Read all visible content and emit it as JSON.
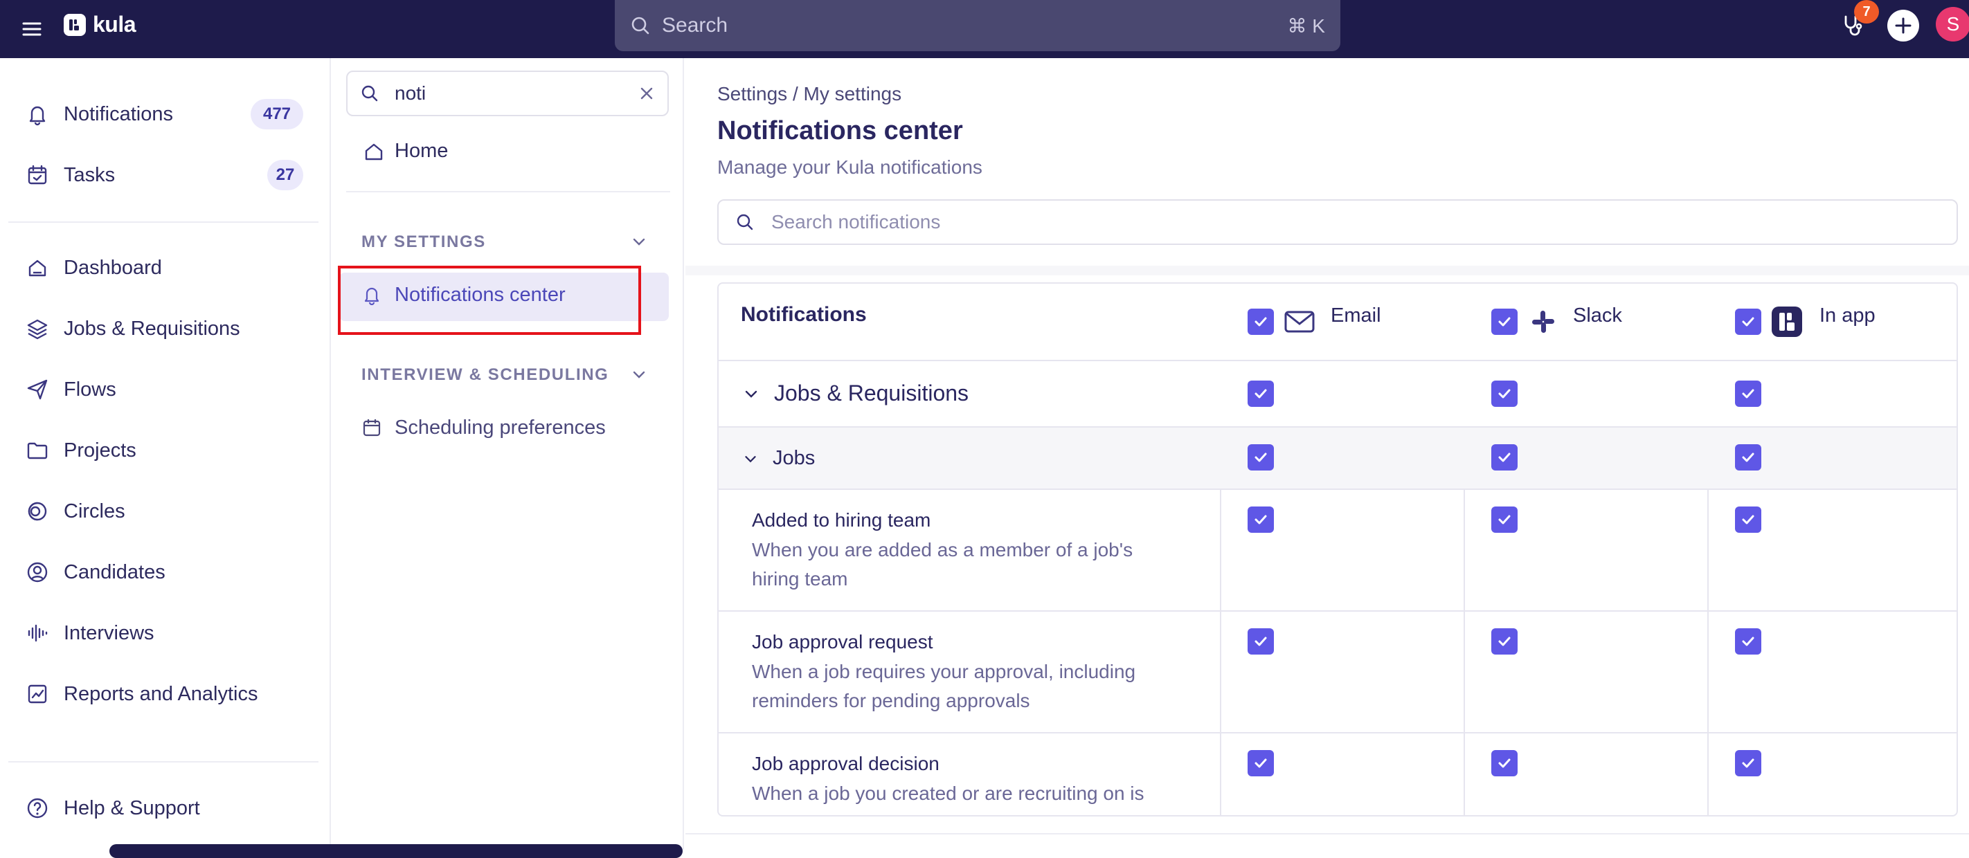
{
  "app": {
    "name": "kula"
  },
  "topbar": {
    "search_placeholder": "Search",
    "search_shortcut": "⌘ K",
    "notification_badge": "7",
    "avatar_initial": "S"
  },
  "sidebar": {
    "items": [
      {
        "label": "Notifications",
        "count": "477",
        "icon": "bell-icon"
      },
      {
        "label": "Tasks",
        "count": "27",
        "icon": "calendar-check-icon"
      },
      {
        "label": "Dashboard",
        "icon": "dashboard-icon"
      },
      {
        "label": "Jobs & Requisitions",
        "icon": "layers-icon"
      },
      {
        "label": "Flows",
        "icon": "send-icon"
      },
      {
        "label": "Projects",
        "icon": "folder-icon"
      },
      {
        "label": "Circles",
        "icon": "circles-icon"
      },
      {
        "label": "Candidates",
        "icon": "user-circle-icon"
      },
      {
        "label": "Interviews",
        "icon": "waveform-icon"
      },
      {
        "label": "Reports and Analytics",
        "icon": "chart-icon"
      }
    ],
    "help_label": "Help & Support"
  },
  "subnav": {
    "search_value": "noti",
    "home_label": "Home",
    "sections": [
      {
        "title": "MY SETTINGS",
        "items": [
          "Notifications center"
        ]
      },
      {
        "title": "INTERVIEW & SCHEDULING",
        "items": [
          "Scheduling preferences"
        ]
      }
    ]
  },
  "main": {
    "breadcrumb": "Settings / My settings",
    "title": "Notifications center",
    "subtitle": "Manage your Kula notifications",
    "search_placeholder": "Search notifications",
    "table": {
      "header": "Notifications",
      "columns": [
        "Email",
        "Slack",
        "In app"
      ],
      "group": "Jobs & Requisitions",
      "subgroup": "Jobs",
      "rows": [
        {
          "title": "Added to hiring team",
          "desc": "When you are added as a member of a job's hiring team"
        },
        {
          "title": "Job approval request",
          "desc": "When a job requires your approval, including reminders for pending approvals"
        },
        {
          "title": "Job approval decision",
          "desc": "When a job you created or are recruiting on is"
        }
      ]
    }
  },
  "colors": {
    "accent": "#5f57e6",
    "nav": "#1e1b4b",
    "highlight": "#e5131b"
  }
}
